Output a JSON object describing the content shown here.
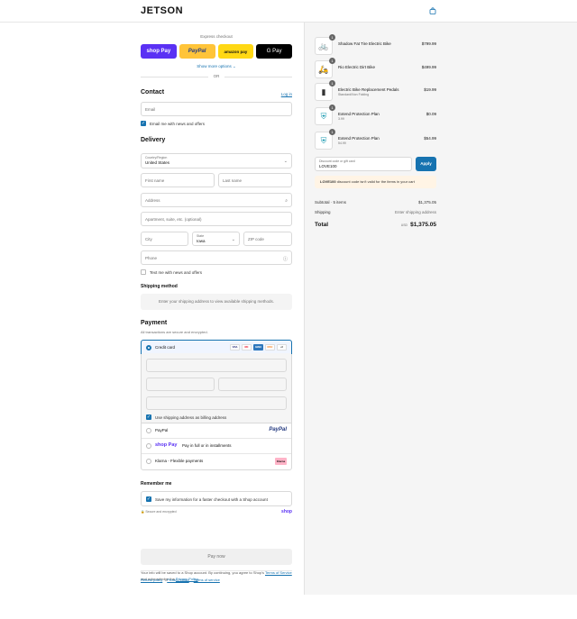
{
  "header": {
    "logo": "JETSON",
    "cart_icon": "shopping-bag-icon",
    "accent": "#1773b0"
  },
  "express": {
    "title": "Express checkout",
    "buttons": [
      {
        "name": "Shop Pay",
        "label": "shop Pay"
      },
      {
        "name": "PayPal",
        "label": "PayPal"
      },
      {
        "name": "Amazon Pay",
        "label": "amazon pay"
      },
      {
        "name": "Google Pay",
        "label": "G Pay"
      }
    ],
    "show_more": "Show more options ⌄",
    "or": "OR"
  },
  "contact": {
    "title": "Contact",
    "login": "Log in",
    "email_placeholder": "Email",
    "news_label": "Email me with news and offers",
    "news_checked": true
  },
  "delivery": {
    "title": "Delivery",
    "country_label": "Country/Region",
    "country_value": "United States",
    "first_name": "First name",
    "last_name": "Last name",
    "address": "Address",
    "apartment": "Apartment, suite, etc. (optional)",
    "city": "City",
    "state_label": "State",
    "state_value": "Iowa",
    "zip": "ZIP code",
    "phone": "Phone",
    "text_me": "Text me with news and offers"
  },
  "shipping": {
    "title": "Shipping method",
    "message": "Enter your shipping address to view available shipping methods."
  },
  "payment": {
    "title": "Payment",
    "subtitle": "All transactions are secure and encrypted.",
    "credit_card": "Credit card",
    "card_brands": [
      "VISA",
      "MC",
      "AMEX",
      "DISC",
      "+6"
    ],
    "billing_label": "Use shipping address as billing address",
    "paypal": "PayPal",
    "paypal_logo": "PayPal",
    "shoppay_logo": "shop Pay",
    "shoppay": "Pay in full or in installments",
    "klarna": "Klarna - Flexible payments",
    "klarna_logo": "Klarna"
  },
  "remember": {
    "title": "Remember me",
    "label": "Save my information for a faster checkout with a Shop account",
    "secure": "🔒 Secure and encrypted",
    "shop": "shop"
  },
  "pay_now": "Pay now",
  "legal": {
    "line1": "Your info will be saved to a Shop account. By continuing, you agree to Shop's",
    "tos": "Terms of Service",
    "and": " and acknowledge the ",
    "privacy": "Privacy Policy",
    "period": "."
  },
  "footer": {
    "refund": "Refund policy",
    "privacy": "Privacy policy",
    "terms": "Terms of service"
  },
  "cart": {
    "items": [
      {
        "qty": "1",
        "name": "Shadow Fat Tire Electric Bike",
        "sub": "",
        "price": "$799.99",
        "icon": "bike-icon"
      },
      {
        "qty": "1",
        "name": "Rio Electric Dirt Bike",
        "sub": "",
        "price": "$499.99",
        "icon": "bike-icon"
      },
      {
        "qty": "1",
        "name": "Electric Bike Replacement Pedals",
        "sub": "Standard/Non Folding",
        "price": "$19.99",
        "icon": "pedal-icon"
      },
      {
        "qty": "1",
        "name": "Extend Protection Plan",
        "sub": "3.99",
        "price": "$0.09",
        "icon": "shield-icon"
      },
      {
        "qty": "1",
        "name": "Extend Protection Plan",
        "sub": "54.99",
        "price": "$54.99",
        "icon": "shield-icon"
      }
    ],
    "discount_label": "Discount code or gift card",
    "discount_value": "LOVE100",
    "apply": "Apply",
    "warning_code": "LOVE100",
    "warning_text": " discount code isn't valid for the items in your cart",
    "subtotal_label": "Subtotal · 5 items",
    "subtotal_value": "$1,375.05",
    "shipping_label": "Shipping",
    "shipping_value": "Enter shipping address",
    "total_label": "Total",
    "currency": "USD",
    "total_value": "$1,375.05"
  }
}
